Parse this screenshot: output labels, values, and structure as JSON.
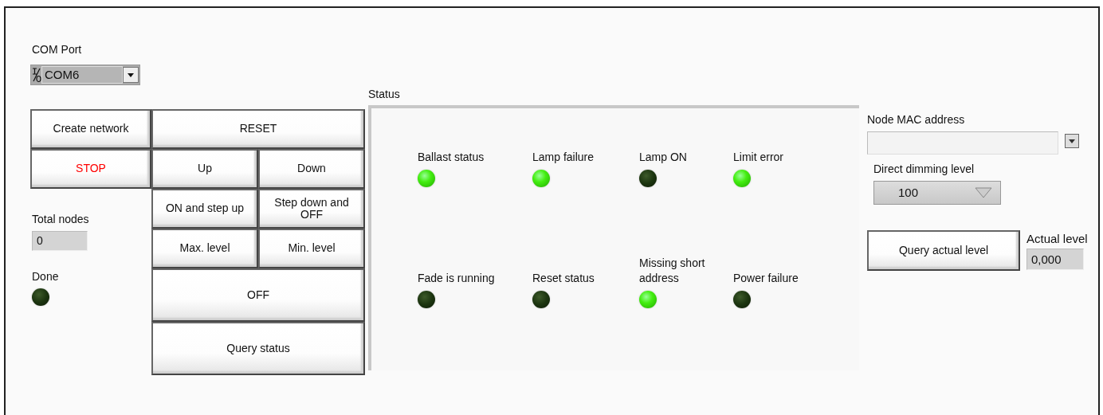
{
  "com_port": {
    "label": "COM Port",
    "value": "COM6"
  },
  "buttons": [
    {
      "label": "Create network",
      "kind": "normal"
    },
    {
      "label": "RESET",
      "kind": "normal"
    },
    {
      "label": "STOP",
      "kind": "stop"
    },
    {
      "label": "Up",
      "kind": "normal"
    },
    {
      "label": "Down",
      "kind": "normal"
    },
    {
      "label": "ON and step up",
      "kind": "normal"
    },
    {
      "label": "Step down and OFF",
      "kind": "normal"
    },
    {
      "label": "Max. level",
      "kind": "normal"
    },
    {
      "label": "Min. level",
      "kind": "normal"
    },
    {
      "label": "OFF",
      "kind": "normal"
    },
    {
      "label": "Query status",
      "kind": "normal"
    }
  ],
  "total_nodes": {
    "label": "Total nodes",
    "value": "0"
  },
  "done": {
    "label": "Done",
    "on": false
  },
  "status": {
    "title": "Status",
    "indicators": [
      {
        "label": "Ballast status",
        "on": true
      },
      {
        "label": "Lamp failure",
        "on": true
      },
      {
        "label": "Lamp ON",
        "on": false
      },
      {
        "label": "Limit error",
        "on": true
      },
      {
        "label": "Fade is running",
        "on": false
      },
      {
        "label": "Reset status",
        "on": false
      },
      {
        "label": "Missing short address",
        "on": true
      },
      {
        "label": "Power failure",
        "on": false
      }
    ]
  },
  "node_mac": {
    "label": "Node MAC address"
  },
  "dimming": {
    "label": "Direct dimming level",
    "value": "100"
  },
  "query_actual": {
    "label": "Query actual level"
  },
  "actual_level": {
    "label": "Actual level",
    "value": "0,000"
  }
}
